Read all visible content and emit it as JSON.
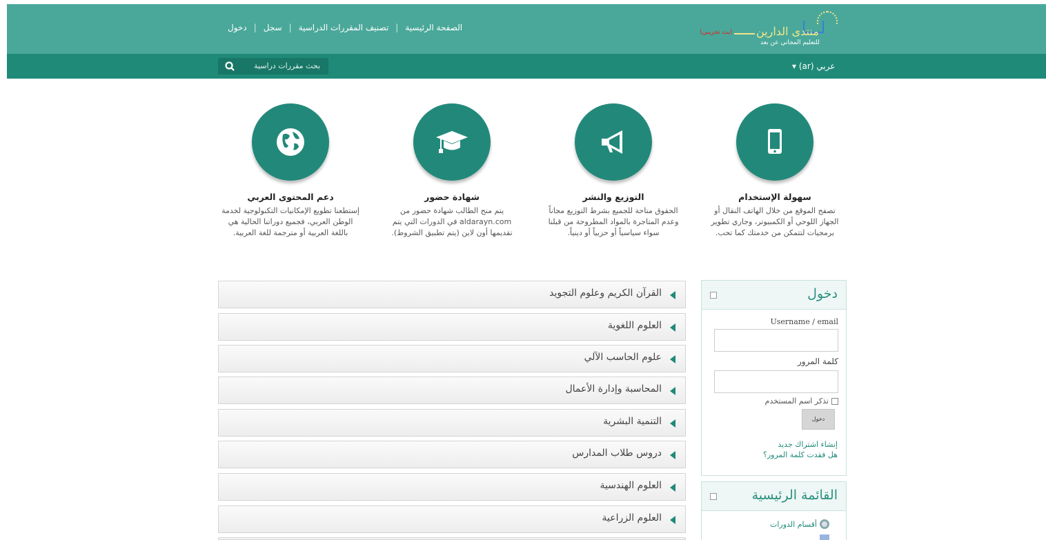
{
  "header": {
    "nav": [
      {
        "label": "الصفحة الرئيسية"
      },
      {
        "label": "تصنيف المقررات الدراسية"
      },
      {
        "label": "سجل"
      },
      {
        "label": "دخول"
      }
    ],
    "logo": {
      "trial": "(بث تجريبي)",
      "name": "منتدى الدارين",
      "tagline": "للتعليم المجاني عن بعد"
    },
    "search_placeholder": "بحث مقررات دراسية",
    "language": "عربي (ar) ▾"
  },
  "features": [
    {
      "title": "سهولة الإستخدام",
      "text": "تصفح الموقع من خلال الهاتف النقال أو الجهاز اللوحي أو الكمبيوتر، وجاري تطوير برمجيات لتتمكن من خدمتك كما تحب.",
      "icon": "mobile-icon"
    },
    {
      "title": "التوزيع والنشر",
      "text": "الحقوق متاحة للجميع بشرط التوزيع مجاناً وعدم المتاجرة بالمواد المطروحة من قبلنا سواء سياسياً أو حزبياً أو دينياً.",
      "icon": "megaphone-icon"
    },
    {
      "title": "شهادة حضور",
      "text": "يتم منح الطالب شهادة حضور من aldarayn.com في الدورات التي يتم تقديمها أون لاين (يتم تطبيق الشروط).",
      "icon": "graduation-cap-icon"
    },
    {
      "title": "دعم المحتوى العربي",
      "text": "إستطعنا تطويع الإمكانيات التكنولوجية لخدمة الوطن العربي، فجميع دوراتنا الحالية هي باللغة العربية أو مترجمة للغة العربية.",
      "icon": "globe-icon"
    }
  ],
  "categories": [
    {
      "label": "القرآن الكريم وعلوم التجويد"
    },
    {
      "label": "العلوم اللغوية"
    },
    {
      "label": "علوم الحاسب الآلي"
    },
    {
      "label": "المحاسبة وإدارة الأعمال"
    },
    {
      "label": "التنمية البشرية"
    },
    {
      "label": "دروس طلاب المدارس"
    },
    {
      "label": "العلوم الهندسية"
    },
    {
      "label": "العلوم الزراعية"
    }
  ],
  "login": {
    "title": "دخول",
    "username_label": "Username / email",
    "password_label": "كلمة المرور",
    "remember_label": "تذكر اسم المستخدم",
    "submit_label": "دخول",
    "signup_link": "إنشاء اشتراك جديد",
    "forgot_link": "هل فقدت كلمة المرور؟"
  },
  "main_menu": {
    "title": "القائمة الرئيسية",
    "items": [
      {
        "label": "أقسام الدورات"
      }
    ]
  },
  "colors": {
    "header": "#4aa89a",
    "bar": "#1f8a78",
    "accent": "#22897a"
  }
}
